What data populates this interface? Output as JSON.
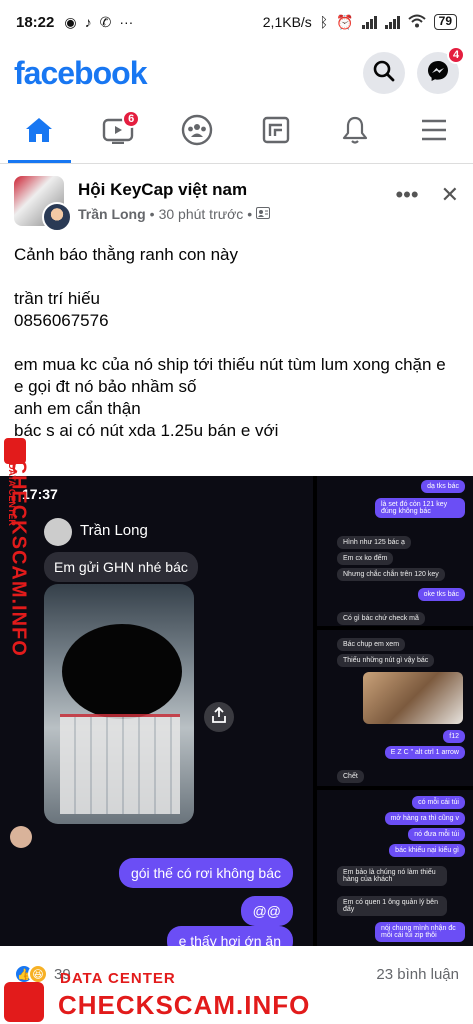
{
  "status_bar": {
    "time": "18:22",
    "network_speed": "2,1KB/s",
    "battery": "79"
  },
  "header": {
    "logo": "facebook",
    "messenger_badge": "4"
  },
  "nav": {
    "video_badge": "6"
  },
  "post": {
    "group": "Hội KeyCap việt nam",
    "author": "Trần Long",
    "time": "30 phút trước",
    "text": "Cảnh báo thằng ranh con này\n\ntrần trí hiếu\n0856067576\n\nem mua kc của nó ship tới thiếu nút tùm lum xong chặn e e gọi đt nó bảo nhầm số\nanh em cẩn thận\nbác s ai có nút xda 1.25u bán e với",
    "reactions_count": "39",
    "comments": "23 bình luận"
  },
  "screenshot_main": {
    "time": "17:37",
    "contact": "Trần Long",
    "msg1": "Em gửi GHN nhé bác",
    "msg2": "gói thế có rơi không bác",
    "msg3": "@@",
    "msg4": "e thấy hơi ớn ăn"
  },
  "screenshot_1": {
    "m1": "dạ tks bác",
    "m2": "là set đó còn 121 key đúng không bác",
    "m3": "Hình như 125 bác ạ",
    "m4": "Em cx ko đếm",
    "m5": "Nhưng chắc chắn trên 120 key",
    "m6": "oke tks bác",
    "m7": "Có gì bác chứ check mã"
  },
  "screenshot_2": {
    "m1": "Bác chụp em xem",
    "m2": "Thiếu những nút gì vậy bác",
    "m3": "f12",
    "m4": "E Z C \" alt ctrl 1 arrow",
    "m5": "Chết"
  },
  "screenshot_3": {
    "m1": "có mỗi cái túi",
    "m2": "mở hàng ra thì cũng v",
    "m3": "nó đưa mỗi túi",
    "m4": "bác khiếu nại kiểu gì",
    "m5": "Em bảo là chúng nó làm thiếu hàng của khách",
    "m6": "Em có quen 1 ông quản lý bên đấy",
    "m7": "nói chung mình nhận đc mỗi cái túi zip thôi"
  },
  "watermark": {
    "label": "DATA CENTER",
    "site": "CHECKSCAM.INFO"
  },
  "colors": {
    "brand": "#1877f2",
    "watermark": "#e21b1b",
    "bubble": "#6b4ef5"
  },
  "icons": [
    "home-icon",
    "video-icon",
    "groups-icon",
    "marketplace-icon",
    "bell-icon",
    "menu-icon",
    "search-icon",
    "messenger-icon"
  ]
}
